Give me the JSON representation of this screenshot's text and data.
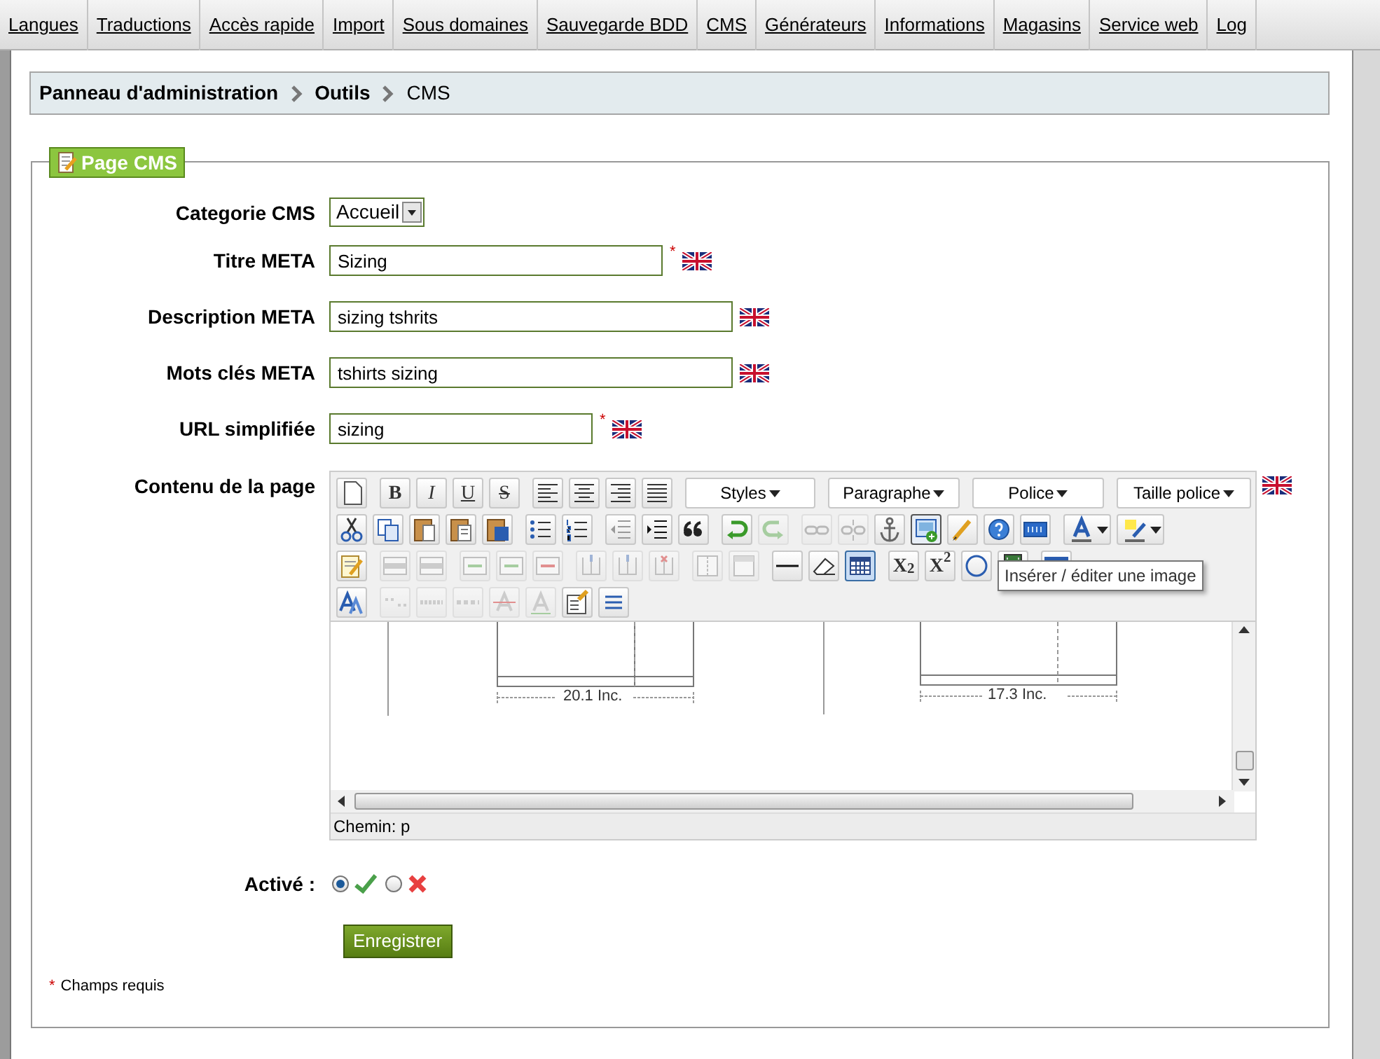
{
  "nav": [
    {
      "label": "Langues"
    },
    {
      "label": "Traductions"
    },
    {
      "label": "Accès rapide"
    },
    {
      "label": "Import"
    },
    {
      "label": "Sous domaines"
    },
    {
      "label": "Sauvegarde BDD"
    },
    {
      "label": "CMS"
    },
    {
      "label": "Générateurs"
    },
    {
      "label": "Informations"
    },
    {
      "label": "Magasins"
    },
    {
      "label": "Service web"
    },
    {
      "label": "Log"
    }
  ],
  "breadcrumb": [
    "Panneau d'administration",
    "Outils",
    "CMS"
  ],
  "panel": {
    "title": "Page CMS"
  },
  "fields": [
    {
      "kind": "select",
      "label": "Categorie CMS",
      "value": "Accueil"
    },
    {
      "kind": "text",
      "label": "Titre META",
      "value": "Sizing",
      "required_mark": "*"
    },
    {
      "kind": "text",
      "label": "Description META",
      "value": "sizing tshrits"
    },
    {
      "kind": "text",
      "label": "Mots clés META",
      "value": "tshirts sizing"
    },
    {
      "kind": "text",
      "label": "URL simplifiée",
      "value": "sizing",
      "required_mark": "*"
    }
  ],
  "editor": {
    "label": "Contenu de la page",
    "toolbar": [
      [
        [
          {
            "kind": "icon"
          }
        ],
        [
          {
            "kind": "letter",
            "label": "B"
          },
          {
            "kind": "letter",
            "label": "I"
          },
          {
            "kind": "letter",
            "label": "U"
          },
          {
            "kind": "letter",
            "label": "S"
          }
        ],
        [
          {
            "kind": "icon"
          },
          {
            "kind": "icon"
          },
          {
            "kind": "icon"
          },
          {
            "kind": "icon"
          }
        ],
        [
          {
            "kind": "dropdown",
            "label": "Styles"
          }
        ],
        [
          {
            "kind": "dropdown",
            "label": "Paragraphe"
          }
        ],
        [
          {
            "kind": "dropdown",
            "label": "Police"
          }
        ],
        [
          {
            "kind": "dropdown",
            "label": "Taille police"
          }
        ]
      ],
      [
        [
          {
            "kind": "icon"
          },
          {
            "kind": "icon"
          },
          {
            "kind": "icon"
          },
          {
            "kind": "icon"
          },
          {
            "kind": "icon"
          }
        ],
        [
          {
            "kind": "icon"
          },
          {
            "kind": "icon"
          }
        ],
        [
          {
            "kind": "icon"
          },
          {
            "kind": "icon"
          },
          {
            "kind": "icon"
          }
        ],
        [
          {
            "kind": "icon"
          },
          {
            "kind": "icon",
            "disabled": true
          }
        ],
        [
          {
            "kind": "icon",
            "disabled": true
          },
          {
            "kind": "icon",
            "disabled": true
          },
          {
            "kind": "icon"
          },
          {
            "kind": "icon",
            "hovered": true
          },
          {
            "kind": "icon"
          },
          {
            "kind": "icon"
          },
          {
            "kind": "icon"
          }
        ],
        [
          {
            "kind": "split"
          },
          {
            "kind": "split"
          }
        ]
      ],
      [
        [
          {
            "kind": "icon"
          }
        ],
        [
          {
            "kind": "icon",
            "disabled": true
          },
          {
            "kind": "icon",
            "disabled": true
          }
        ],
        [
          {
            "kind": "icon",
            "disabled": true
          },
          {
            "kind": "icon",
            "disabled": true
          },
          {
            "kind": "icon",
            "disabled": true
          }
        ],
        [
          {
            "kind": "icon",
            "disabled": true
          },
          {
            "kind": "icon",
            "disabled": true
          },
          {
            "kind": "icon",
            "disabled": true
          }
        ],
        [
          {
            "kind": "icon",
            "disabled": true
          },
          {
            "kind": "icon",
            "disabled": true
          }
        ],
        [
          {
            "kind": "icon"
          },
          {
            "kind": "icon"
          },
          {
            "kind": "icon",
            "selected": true
          }
        ],
        [
          {
            "kind": "letter",
            "label": "X$_{2}$"
          },
          {
            "kind": "letter",
            "label": "X$^{2}$"
          },
          {
            "kind": "icon"
          },
          {
            "kind": "icon"
          }
        ],
        [
          {
            "kind": "icon"
          }
        ]
      ],
      [
        [
          {
            "kind": "icon"
          }
        ],
        [
          {
            "kind": "icon",
            "disabled": true
          },
          {
            "kind": "icon",
            "disabled": true
          },
          {
            "kind": "icon",
            "disabled": true
          },
          {
            "kind": "icon",
            "disabled": true
          },
          {
            "kind": "icon",
            "disabled": true
          },
          {
            "kind": "icon"
          },
          {
            "kind": "icon"
          }
        ]
      ]
    ],
    "tooltip": "Insérer / éditer une image",
    "measurements": [
      "20.1 Inc.",
      "17.3 Inc."
    ],
    "path": "Chemin: p"
  },
  "active": {
    "label": "Activé :",
    "options": [
      {
        "kind": "yes",
        "selected": true
      },
      {
        "kind": "no",
        "selected": false
      }
    ]
  },
  "save_button": "Enregistrer",
  "note": {
    "mark": "*",
    "text": "Champs requis"
  }
}
